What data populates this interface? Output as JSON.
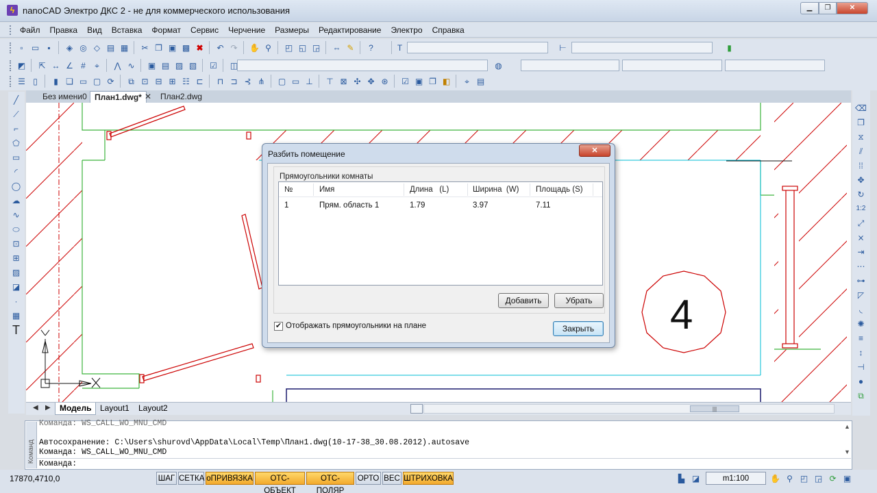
{
  "window": {
    "title": "nanoCAD Электро ДКС 2 - не для коммерческого использования",
    "icon": "lightning-app-icon",
    "min_glyph": "▁",
    "max_glyph": "❐",
    "close_glyph": "✕"
  },
  "menu": [
    "Файл",
    "Правка",
    "Вид",
    "Вставка",
    "Формат",
    "Сервис",
    "Черчение",
    "Размеры",
    "Редактирование",
    "Электро",
    "Справка"
  ],
  "doc_tabs": {
    "noname": "Без имени0",
    "plan1": "План1.dwg*",
    "plan1_close": "✕",
    "plan2": "План2.dwg"
  },
  "layout_tabs": {
    "model": "Модель",
    "layout1": "Layout1",
    "layout2": "Layout2",
    "prev": "◀",
    "next": "▶"
  },
  "command": {
    "lines": [
      "Команда: WS_CALL_WO_MNU_CMD",
      "Автосохранение: C:\\Users\\shurovd\\AppData\\Local\\Temp\\План1.dwg(10-17-38_30.08.2012).autosave",
      "Команда: WS_CALL_WO_MNU_CMD",
      "Команда:"
    ],
    "side_label": "Команд"
  },
  "status": {
    "coords": "17870,4710,0",
    "buttons": [
      {
        "label": "ШАГ",
        "on": false
      },
      {
        "label": "СЕТКА",
        "on": false
      },
      {
        "label": "оПРИВЯЗКА",
        "on": true
      },
      {
        "label": "ОТС-ОБЪЕКТ",
        "on": true
      },
      {
        "label": "ОТС-ПОЛЯР",
        "on": true
      },
      {
        "label": "ОРТО",
        "on": false
      },
      {
        "label": "ВЕС",
        "on": false
      },
      {
        "label": "ШТРИХОВКА",
        "on": true
      }
    ],
    "scale": "m1:100"
  },
  "dialog": {
    "title": "Разбить помещение",
    "close_glyph": "✕",
    "group_label": "Прямоугольники комнаты",
    "columns": [
      "№",
      "Имя",
      "Длина   (L)",
      "Ширина  (W)",
      "Площадь (S)"
    ],
    "rows": [
      [
        "1",
        "Прям. область 1",
        "1.79",
        "3.97",
        "7.11"
      ]
    ],
    "add_label": "Добавить",
    "remove_label": "Убрать",
    "checkbox_label": "Отображать прямоугольники на плане",
    "checkbox_checked": true,
    "close_label": "Закрыть"
  },
  "drawing": {
    "room_number": "4"
  },
  "colors": {
    "wall_green": "#3cb33c",
    "door_red": "#cc0000",
    "cyan": "#00bcd4",
    "navy": "#1c1c6e",
    "status_on": "#f2a92c"
  }
}
